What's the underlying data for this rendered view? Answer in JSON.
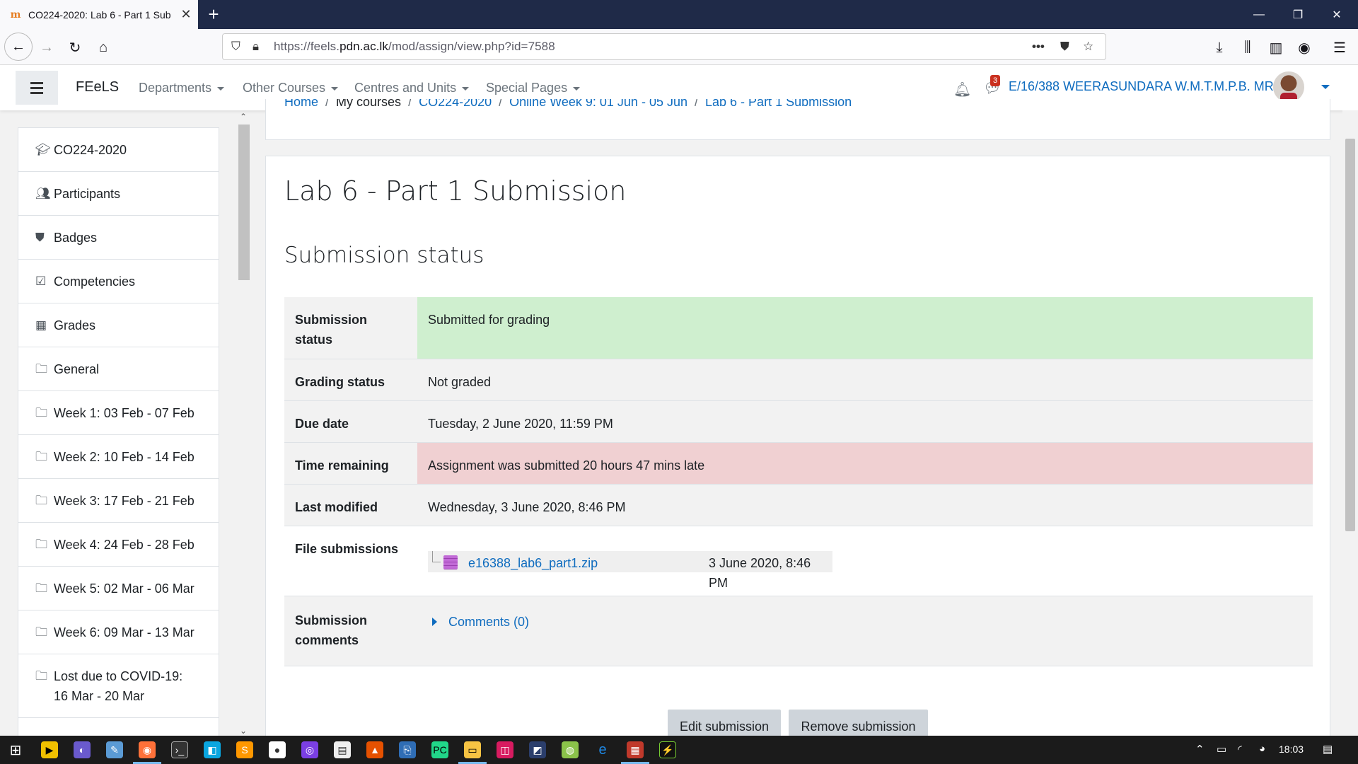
{
  "browser": {
    "tab_title": "CO224-2020: Lab 6 - Part 1 Sub",
    "url_prefix": "https://feels.",
    "url_domain": "pdn.ac.lk",
    "url_path": "/mod/assign/view.php?id=7588"
  },
  "navbar": {
    "brand": "FEeLS",
    "menus": [
      "Departments",
      "Other Courses",
      "Centres and Units",
      "Special Pages"
    ],
    "message_count": "3",
    "user_name": "E/16/388 WEERASUNDARA W.M.T.M.P.B. MR"
  },
  "sidebar": {
    "items": [
      {
        "label": "CO224-2020",
        "icon": "graduation-cap-icon"
      },
      {
        "label": "Participants",
        "icon": "users-icon"
      },
      {
        "label": "Badges",
        "icon": "shield-icon"
      },
      {
        "label": "Competencies",
        "icon": "check-square-icon"
      },
      {
        "label": "Grades",
        "icon": "table-icon"
      },
      {
        "label": "General",
        "icon": "folder-icon"
      },
      {
        "label": "Week 1: 03 Feb - 07 Feb",
        "icon": "folder-icon"
      },
      {
        "label": "Week 2: 10 Feb - 14 Feb",
        "icon": "folder-icon"
      },
      {
        "label": "Week 3: 17 Feb - 21 Feb",
        "icon": "folder-icon"
      },
      {
        "label": "Week 4: 24 Feb - 28 Feb",
        "icon": "folder-icon"
      },
      {
        "label": "Week 5: 02 Mar - 06 Mar",
        "icon": "folder-icon"
      },
      {
        "label": "Week 6: 09 Mar - 13 Mar",
        "icon": "folder-icon"
      },
      {
        "label": "Lost due to COVID-19: 16 Mar - 20 Mar",
        "icon": "folder-icon"
      }
    ]
  },
  "breadcrumb": {
    "home": "Home",
    "my_courses": "My courses",
    "course": "CO224-2020",
    "week": "Online Week 9: 01 Jun - 05 Jun",
    "current": "Lab 6 - Part 1 Submission"
  },
  "main": {
    "page_title": "Lab 6 - Part 1 Submission",
    "section_title": "Submission status",
    "rows": {
      "submission_status": {
        "label": "Submission status",
        "value": "Submitted for grading"
      },
      "grading_status": {
        "label": "Grading status",
        "value": "Not graded"
      },
      "due_date": {
        "label": "Due date",
        "value": "Tuesday, 2 June 2020, 11:59 PM"
      },
      "time_remaining": {
        "label": "Time remaining",
        "value": "Assignment was submitted 20 hours 47 mins late"
      },
      "last_modified": {
        "label": "Last modified",
        "value": "Wednesday, 3 June 2020, 8:46 PM"
      },
      "file_submissions": {
        "label": "File submissions",
        "file_name": "e16388_lab6_part1.zip",
        "file_date": "3 June 2020, 8:46 PM"
      },
      "submission_comments": {
        "label": "Submission comments",
        "link": "Comments (0)"
      }
    },
    "buttons": {
      "edit": "Edit submission",
      "remove": "Remove submission"
    }
  },
  "taskbar": {
    "time": "18:03"
  },
  "colors": {
    "link": "#0f6cbf",
    "success_bg": "#cfefcf",
    "danger_bg": "#f0d0d2",
    "chrome_dark": "#1f2a48"
  }
}
